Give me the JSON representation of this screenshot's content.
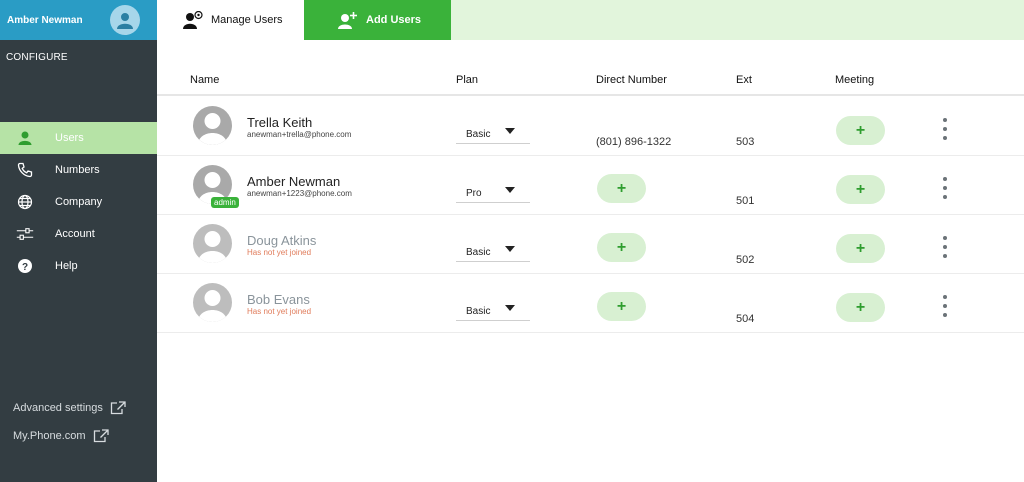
{
  "sidebar": {
    "user_name": "Amber Newman",
    "section_label": "CONFIGURE",
    "items": [
      {
        "label": "Users",
        "icon": "user-icon",
        "active": true
      },
      {
        "label": "Numbers",
        "icon": "phone-icon",
        "active": false
      },
      {
        "label": "Company",
        "icon": "globe-icon",
        "active": false
      },
      {
        "label": "Account",
        "icon": "sliders-icon",
        "active": false
      },
      {
        "label": "Help",
        "icon": "help-icon",
        "active": false
      }
    ],
    "links": [
      {
        "label": "Advanced settings",
        "icon": "external-link-icon"
      },
      {
        "label": "My.Phone.com",
        "icon": "external-link-icon"
      }
    ]
  },
  "tabs": {
    "manage": "Manage Users",
    "add": "Add Users"
  },
  "table": {
    "headers": {
      "name": "Name",
      "plan": "Plan",
      "direct": "Direct Number",
      "ext": "Ext",
      "meeting": "Meeting"
    },
    "rows": [
      {
        "name": "Trella Keith",
        "sub": "anewman+trella@phone.com",
        "pending": false,
        "admin": "",
        "plan": "Basic",
        "direct": "(801) 896-1322",
        "ext": "503",
        "meeting_btn": "+",
        "direct_btn": ""
      },
      {
        "name": "Amber Newman",
        "sub": "anewman+1223@phone.com",
        "pending": false,
        "admin": "admin",
        "plan": "Pro",
        "direct": "",
        "ext": "501",
        "meeting_btn": "+",
        "direct_btn": "+"
      },
      {
        "name": "Doug Atkins",
        "sub": "Has not yet joined",
        "pending": true,
        "admin": "",
        "plan": "Basic",
        "direct": "",
        "ext": "502",
        "meeting_btn": "+",
        "direct_btn": "+"
      },
      {
        "name": "Bob Evans",
        "sub": "Has not yet joined",
        "pending": true,
        "admin": "",
        "plan": "Basic",
        "direct": "",
        "ext": "504",
        "meeting_btn": "+",
        "direct_btn": "+"
      }
    ]
  },
  "colors": {
    "sidebar_bg": "#333d42",
    "header_blue": "#2a9cc5",
    "accent_green": "#3ab23a",
    "light_green": "#d8f0d2",
    "pending_orange": "#e07c5b"
  }
}
